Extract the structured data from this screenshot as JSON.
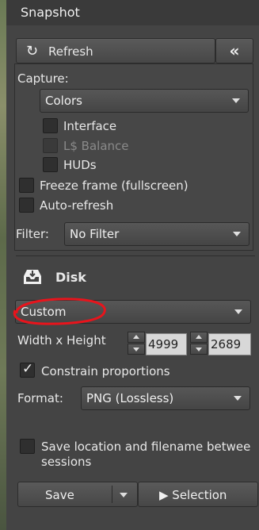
{
  "window": {
    "title": "Snapshot"
  },
  "toolbar": {
    "refresh_label": "Refresh",
    "refresh_icon": "refresh-icon",
    "collapse_icon": "double-chevron-left-icon",
    "collapse_glyph": "«"
  },
  "capture": {
    "label": "Capture:",
    "selected": "Colors",
    "options": [
      {
        "label": "Interface",
        "checked": false,
        "disabled": false
      },
      {
        "label": "L$ Balance",
        "checked": false,
        "disabled": true
      },
      {
        "label": "HUDs",
        "checked": false,
        "disabled": false
      }
    ],
    "freeze_label": "Freeze frame (fullscreen)",
    "autorefresh_label": "Auto-refresh"
  },
  "filter": {
    "label": "Filter:",
    "selected": "No Filter"
  },
  "disk": {
    "heading": "Disk",
    "icon": "inbox-tray-icon",
    "size_preset": "Custom",
    "wh_label": "Width x Height",
    "width": "4999",
    "height": "2689",
    "constrain_label": "Constrain proportions",
    "constrain_checked": true,
    "format_label": "Format:",
    "format": "PNG (Lossless)",
    "save_location_label_line1": "Save location and filename betwee",
    "save_location_label_line2": "sessions",
    "save_label": "Save",
    "selection_label": "▶ Selection"
  },
  "annotation": {
    "color": "#e8141c"
  }
}
